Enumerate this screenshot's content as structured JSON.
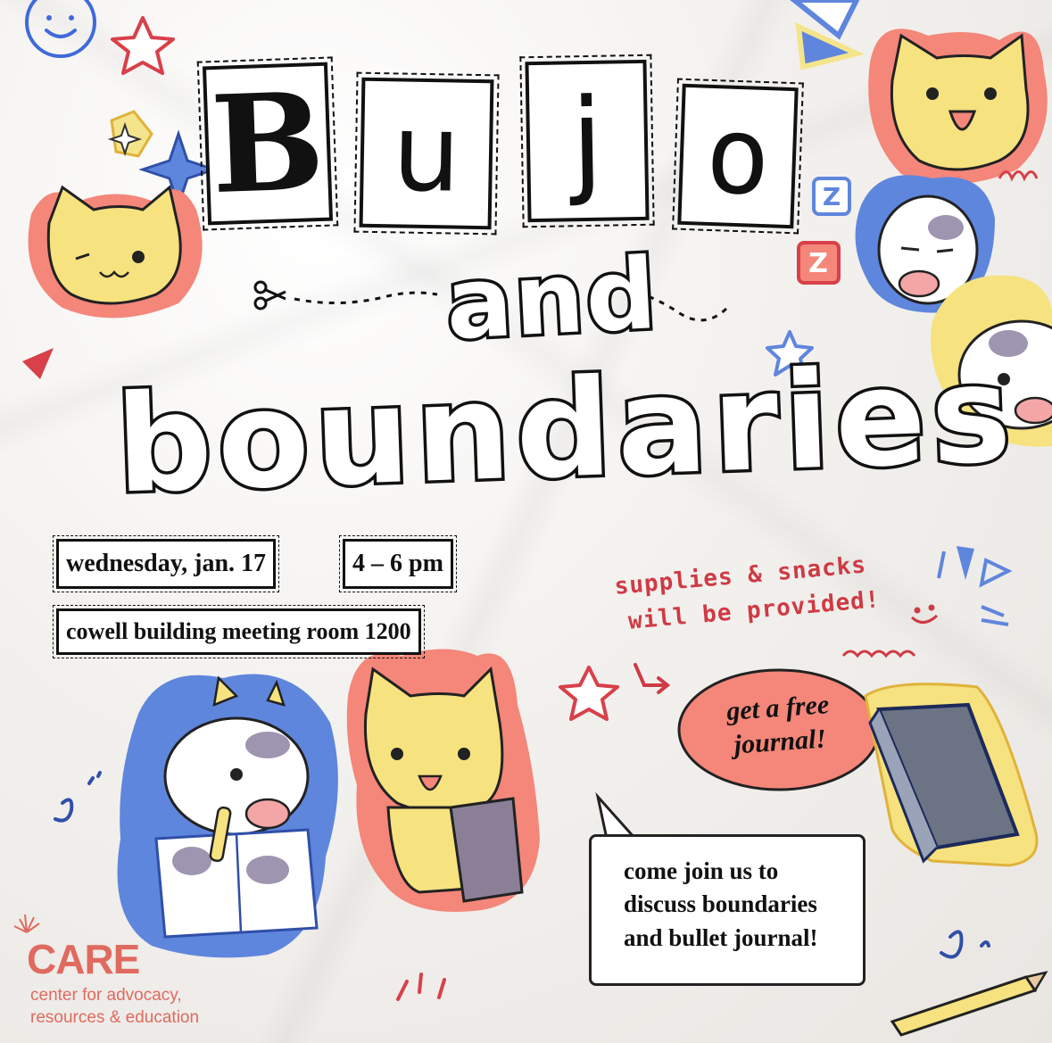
{
  "title": {
    "letters": [
      "B",
      "u",
      "j",
      "o"
    ],
    "connector": "and",
    "subtitle": "boundaries"
  },
  "event": {
    "date": "wednesday, jan. 17",
    "time": "4 – 6 pm",
    "location": "cowell building meeting room 1200"
  },
  "notes": {
    "supplies_line1": "supplies & snacks",
    "supplies_line2": "will be provided!",
    "free_journal_line1": "get a free",
    "free_journal_line2": "journal!"
  },
  "speech_bubble": {
    "line1": "come join us to",
    "line2": "discuss boundaries",
    "line3": "and bullet journal!"
  },
  "organization": {
    "logo": "CARE",
    "name_line1": "center for advocacy,",
    "name_line2": "resources & education"
  },
  "colors": {
    "red": "#cf3a44",
    "salmon": "#f4867a",
    "blue": "#5f86dd",
    "yellow": "#f4e58c",
    "ink": "#111111"
  },
  "icons": [
    "smiley-icon",
    "star-icon",
    "sparkle-icon",
    "scissors-icon",
    "cat-sticker",
    "cow-sticker",
    "sleep-z-icon",
    "journal-book",
    "pencil-icon",
    "arrow-icon"
  ]
}
